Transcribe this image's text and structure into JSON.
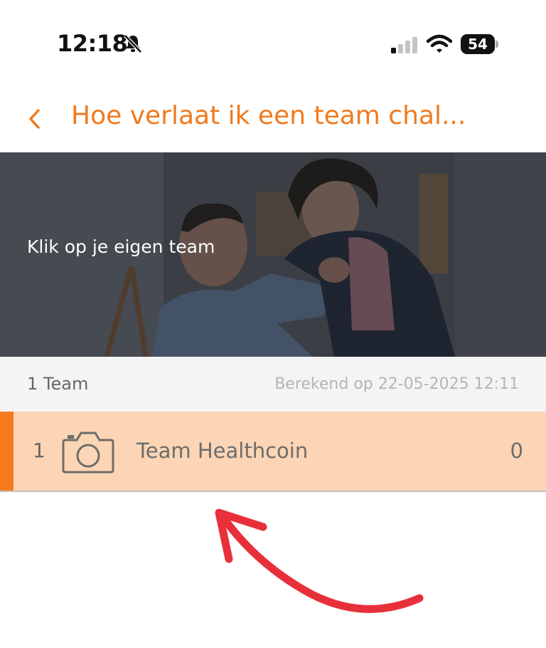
{
  "status_bar": {
    "time": "12:18",
    "battery": "54",
    "icons": [
      "bell-slash-icon",
      "signal-icon",
      "wifi-icon",
      "battery-icon"
    ]
  },
  "header": {
    "back_icon": "chevron-left-icon",
    "title": "Hoe verlaat ik een team chal..."
  },
  "hero": {
    "text": "Klik op je eigen team"
  },
  "list": {
    "count_label": "1 Team",
    "calculated_label": "Berekend op 22-05-2025 12:11",
    "rows": [
      {
        "rank": "1",
        "icon": "camera-icon",
        "name": "Team Healthcoin",
        "score": "0"
      }
    ]
  },
  "annotation": {
    "icon": "red-arrow-icon"
  },
  "colors": {
    "accent": "#f07a1e",
    "row_highlight": "#fbd5b5",
    "row_marker": "#f57b1c",
    "annotation_arrow": "#e8303a"
  }
}
